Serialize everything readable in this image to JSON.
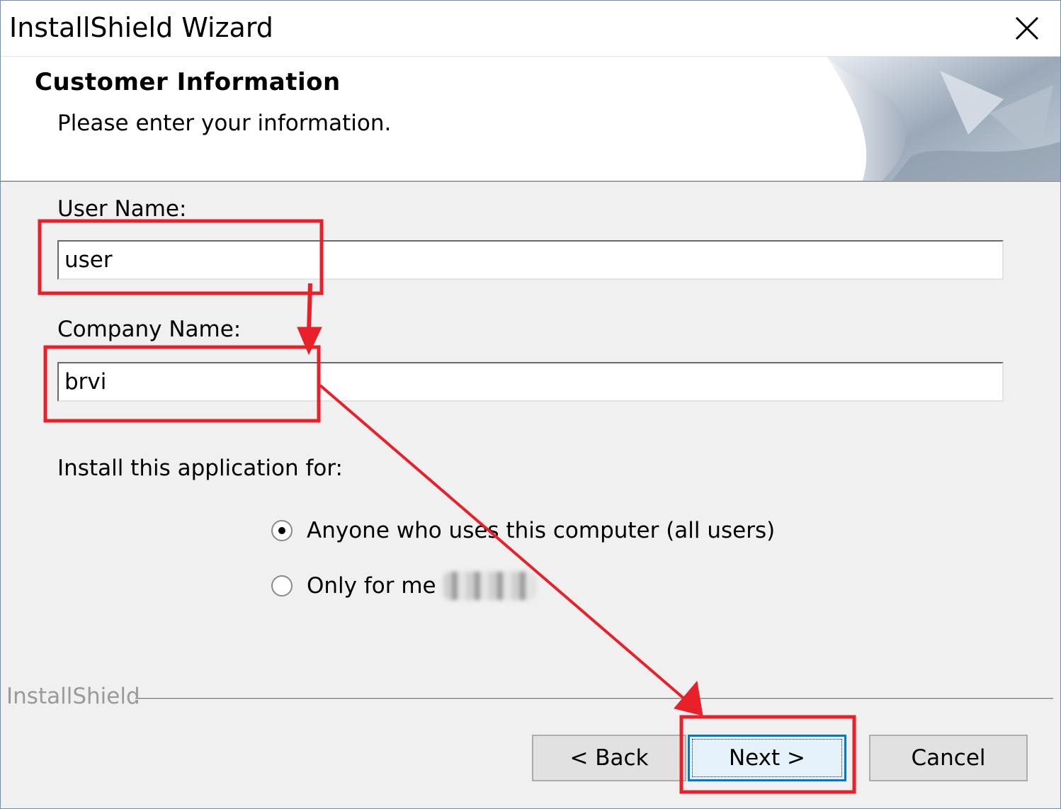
{
  "window": {
    "title": "InstallShield Wizard",
    "close_icon": "close-icon"
  },
  "header": {
    "title": "Customer Information",
    "subtitle": "Please enter your information."
  },
  "form": {
    "user_name_label": "User Name:",
    "user_name_value": "user",
    "company_name_label": "Company Name:",
    "company_name_value": "brvi",
    "install_for_label": "Install this application for:",
    "options": [
      {
        "label": "Anyone who uses this computer (all users)",
        "selected": true
      },
      {
        "label": "Only for me",
        "selected": false
      }
    ]
  },
  "footer": {
    "brand": "InstallShield",
    "back_label": "< Back",
    "next_label": "Next >",
    "cancel_label": "Cancel"
  },
  "annotation": {
    "highlight_color": "#e8202a"
  }
}
